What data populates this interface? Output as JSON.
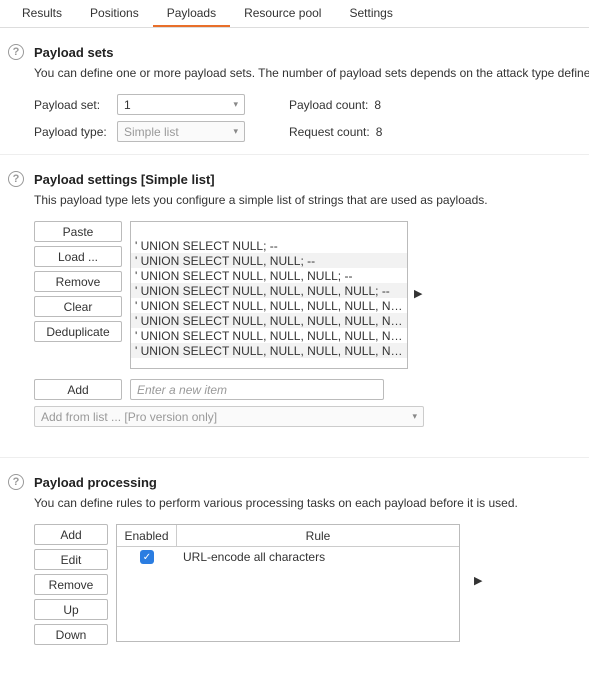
{
  "tabs": [
    "Results",
    "Positions",
    "Payloads",
    "Resource pool",
    "Settings"
  ],
  "active_tab_index": 2,
  "sets": {
    "title": "Payload sets",
    "desc": "You can define one or more payload sets. The number of payload sets depends on the attack type defined in the Positi",
    "set_label": "Payload set:",
    "set_value": "1",
    "type_label": "Payload type:",
    "type_value": "Simple list",
    "payload_count_label": "Payload count:",
    "payload_count_value": "8",
    "request_count_label": "Request count:",
    "request_count_value": "8"
  },
  "settings": {
    "title": "Payload settings [Simple list]",
    "desc": "This payload type lets you configure a simple list of strings that are used as payloads.",
    "buttons": {
      "paste": "Paste",
      "load": "Load ...",
      "remove": "Remove",
      "clear": "Clear",
      "dedup": "Deduplicate",
      "add": "Add"
    },
    "items": [
      "' UNION SELECT NULL; --",
      "' UNION SELECT NULL, NULL; --",
      "' UNION SELECT NULL, NULL, NULL; --",
      "' UNION SELECT NULL, NULL, NULL, NULL; --",
      "' UNION SELECT NULL, NULL, NULL, NULL, NULL; --",
      "' UNION SELECT NULL, NULL, NULL, NULL, NULL, NUL...",
      "' UNION SELECT NULL, NULL, NULL, NULL, NULL, NUL...",
      "' UNION SELECT NULL, NULL, NULL, NULL, NULL, NUL..."
    ],
    "new_item_placeholder": "Enter a new item",
    "add_from_list": "Add from list ... [Pro version only]"
  },
  "processing": {
    "title": "Payload processing",
    "desc": "You can define rules to perform various processing tasks on each payload before it is used.",
    "buttons": {
      "add": "Add",
      "edit": "Edit",
      "remove": "Remove",
      "up": "Up",
      "down": "Down"
    },
    "col_enabled": "Enabled",
    "col_rule": "Rule",
    "rules": [
      {
        "enabled": true,
        "text": "URL-encode all characters"
      }
    ]
  }
}
